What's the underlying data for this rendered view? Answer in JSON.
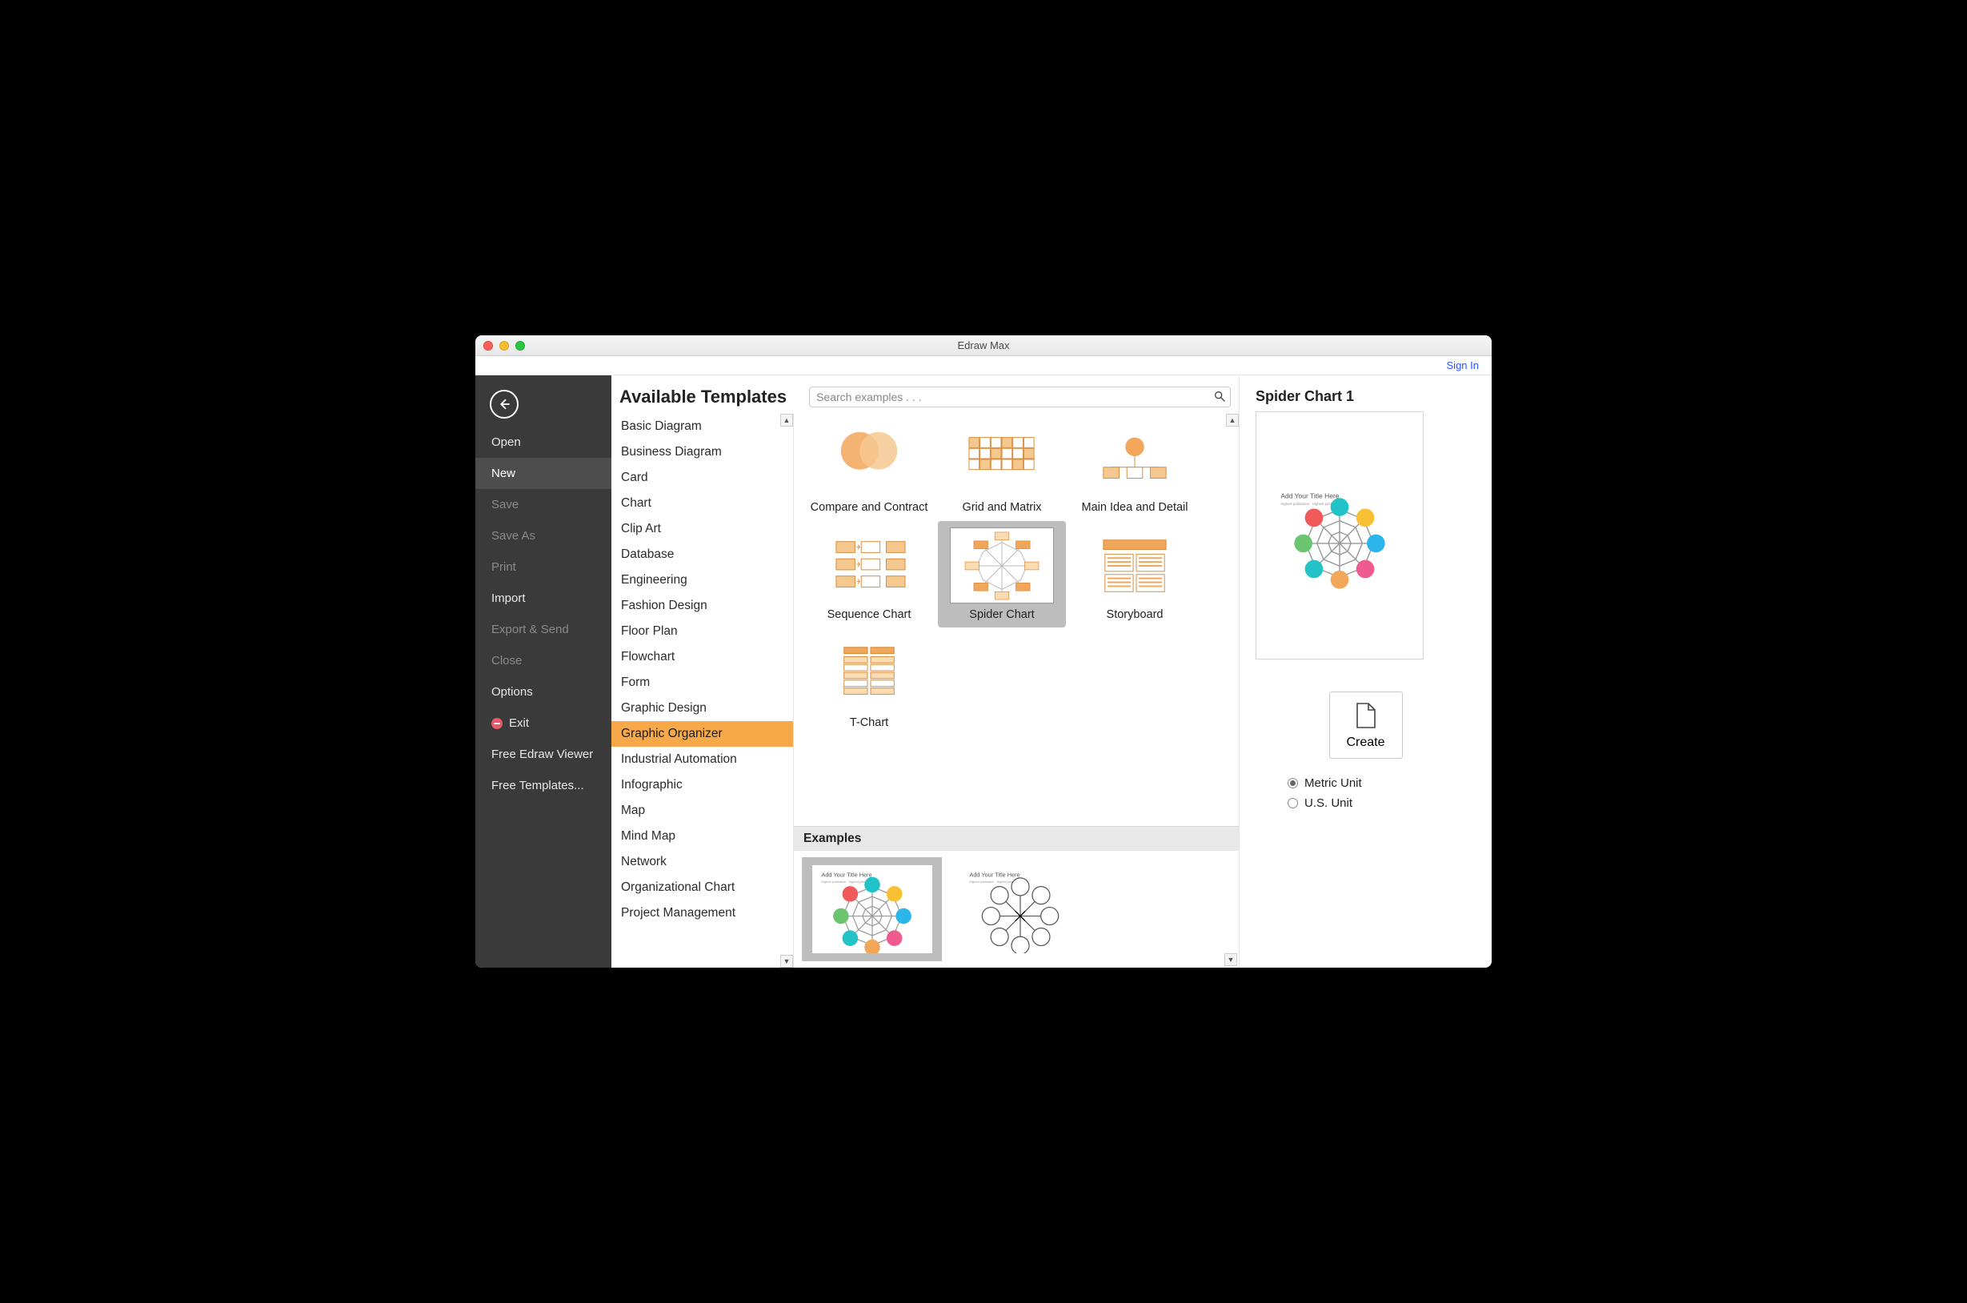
{
  "app": {
    "title": "Edraw Max",
    "signin": "Sign In"
  },
  "sidebar": {
    "items": [
      {
        "label": "Open",
        "disabled": false,
        "active": false
      },
      {
        "label": "New",
        "disabled": false,
        "active": true
      },
      {
        "label": "Save",
        "disabled": true,
        "active": false
      },
      {
        "label": "Save As",
        "disabled": true,
        "active": false
      },
      {
        "label": "Print",
        "disabled": true,
        "active": false
      },
      {
        "label": "Import",
        "disabled": false,
        "active": false
      },
      {
        "label": "Export & Send",
        "disabled": true,
        "active": false
      },
      {
        "label": "Close",
        "disabled": true,
        "active": false
      },
      {
        "label": "Options",
        "disabled": false,
        "active": false
      },
      {
        "label": "Exit",
        "disabled": false,
        "active": false,
        "icon": "exit"
      },
      {
        "label": "Free Edraw Viewer",
        "disabled": false,
        "active": false
      },
      {
        "label": "Free Templates...",
        "disabled": false,
        "active": false
      }
    ]
  },
  "header": {
    "title": "Available Templates",
    "search_placeholder": "Search examples . . ."
  },
  "categories": [
    {
      "label": "Basic Diagram",
      "selected": false
    },
    {
      "label": "Business Diagram",
      "selected": false
    },
    {
      "label": "Card",
      "selected": false
    },
    {
      "label": "Chart",
      "selected": false
    },
    {
      "label": "Clip Art",
      "selected": false
    },
    {
      "label": "Database",
      "selected": false
    },
    {
      "label": "Engineering",
      "selected": false
    },
    {
      "label": "Fashion Design",
      "selected": false
    },
    {
      "label": "Floor Plan",
      "selected": false
    },
    {
      "label": "Flowchart",
      "selected": false
    },
    {
      "label": "Form",
      "selected": false
    },
    {
      "label": "Graphic Design",
      "selected": false
    },
    {
      "label": "Graphic Organizer",
      "selected": true
    },
    {
      "label": "Industrial Automation",
      "selected": false
    },
    {
      "label": "Infographic",
      "selected": false
    },
    {
      "label": "Map",
      "selected": false
    },
    {
      "label": "Mind Map",
      "selected": false
    },
    {
      "label": "Network",
      "selected": false
    },
    {
      "label": "Organizational Chart",
      "selected": false
    },
    {
      "label": "Project Management",
      "selected": false
    }
  ],
  "templates": [
    {
      "label": "Compare and Contract",
      "kind": "venn",
      "selected": false
    },
    {
      "label": "Grid and Matrix",
      "kind": "grid",
      "selected": false
    },
    {
      "label": "Main Idea and Detail",
      "kind": "idea",
      "selected": false
    },
    {
      "label": "Sequence Chart",
      "kind": "sequence",
      "selected": false
    },
    {
      "label": "Spider Chart",
      "kind": "spider",
      "selected": true
    },
    {
      "label": "Storyboard",
      "kind": "storyboard",
      "selected": false
    },
    {
      "label": "T-Chart",
      "kind": "tchart",
      "selected": false
    }
  ],
  "examples": {
    "heading": "Examples",
    "items": [
      {
        "kind": "spider-color",
        "selected": true
      },
      {
        "kind": "spider-plain",
        "selected": false
      }
    ]
  },
  "preview": {
    "title": "Spider Chart 1",
    "kind": "spider-color"
  },
  "create": {
    "label": "Create"
  },
  "units": {
    "options": [
      {
        "label": "Metric Unit",
        "checked": true
      },
      {
        "label": "U.S. Unit",
        "checked": false
      }
    ]
  }
}
